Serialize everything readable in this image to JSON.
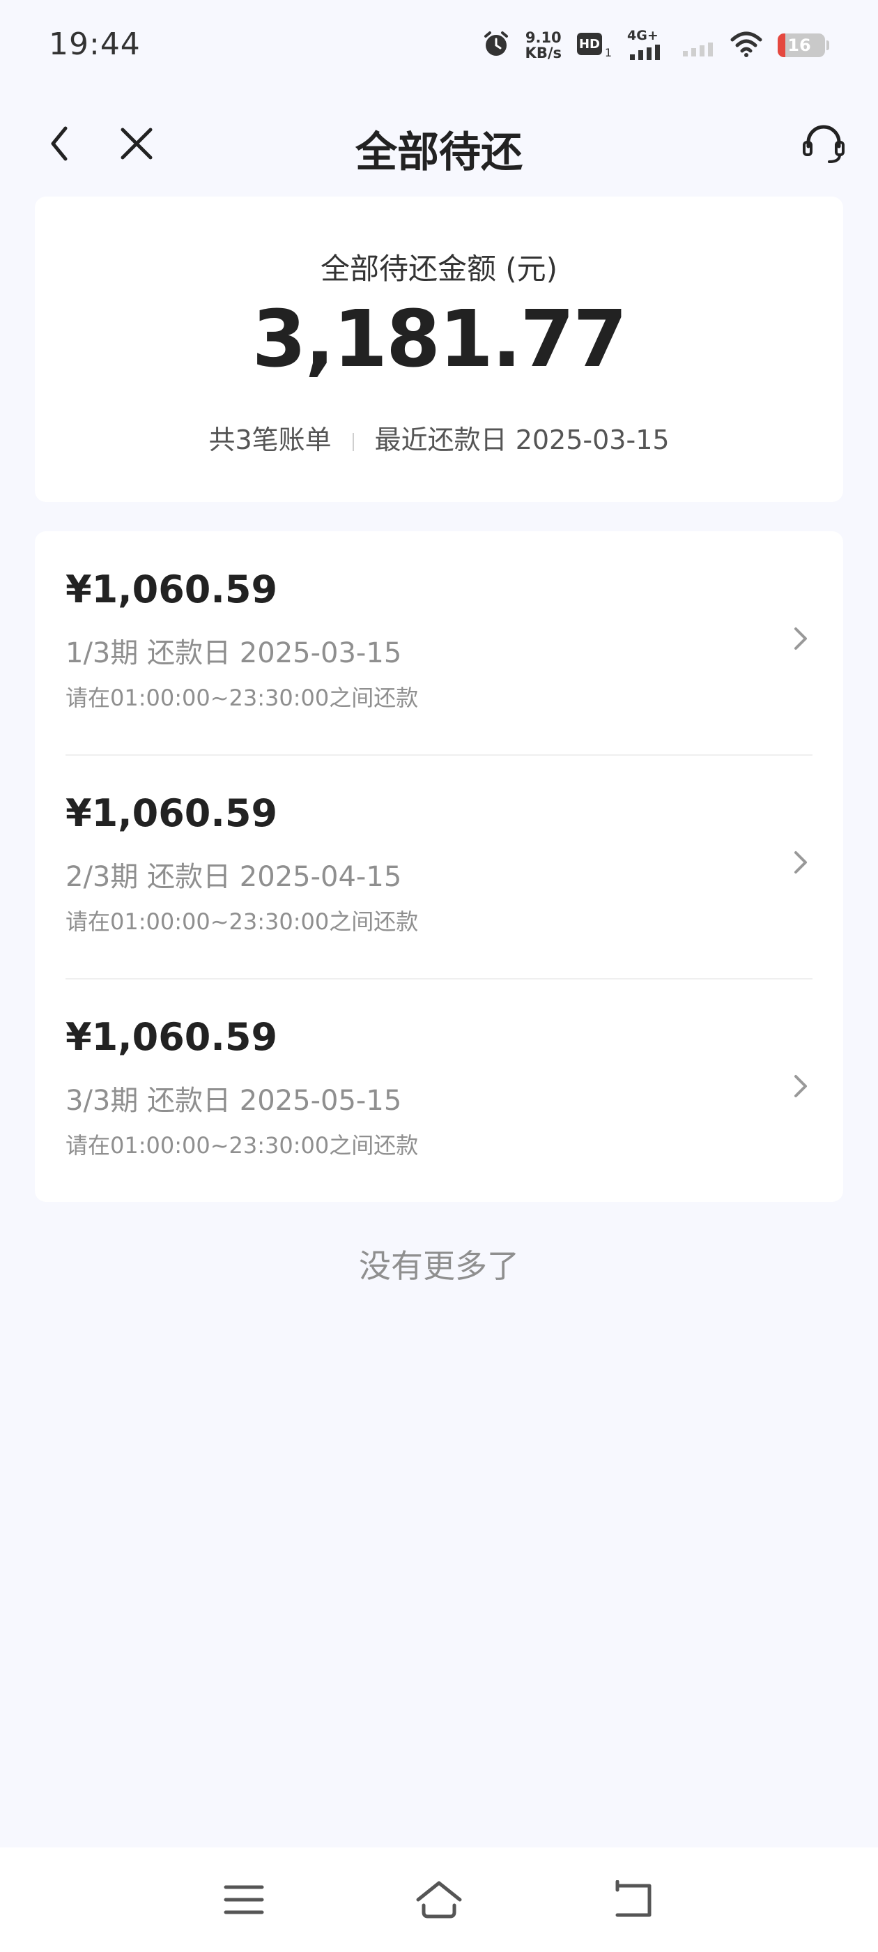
{
  "status_bar": {
    "time": "19:44",
    "net_speed_value": "9.10",
    "net_speed_unit": "KB/s",
    "hd_label": "HD",
    "hd_sub": "1",
    "network_type": "4G+",
    "battery_level": "16",
    "battery_color": "#e5483f"
  },
  "header": {
    "title": "全部待还",
    "back_icon": "chevron-left-icon",
    "close_icon": "close-icon",
    "service_icon": "headset-icon"
  },
  "summary": {
    "label": "全部待还金额 (元)",
    "amount": "3,181.77",
    "bill_count": "共3笔账单",
    "next_due": "最近还款日 2025-03-15"
  },
  "bills": [
    {
      "amount": "¥1,060.59",
      "due": "1/3期 还款日 2025-03-15",
      "hint": "请在01:00:00~23:30:00之间还款"
    },
    {
      "amount": "¥1,060.59",
      "due": "2/3期 还款日 2025-04-15",
      "hint": "请在01:00:00~23:30:00之间还款"
    },
    {
      "amount": "¥1,060.59",
      "due": "3/3期 还款日 2025-05-15",
      "hint": "请在01:00:00~23:30:00之间还款"
    }
  ],
  "footer_text": "没有更多了",
  "system_nav": {
    "menu_icon": "menu-icon",
    "home_icon": "home-icon",
    "back_icon": "back-icon"
  }
}
